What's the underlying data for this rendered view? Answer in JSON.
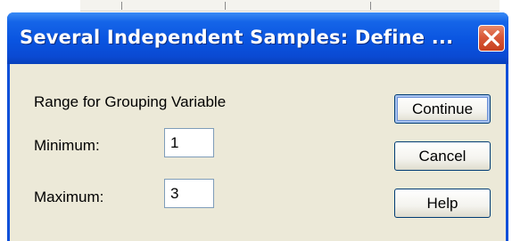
{
  "window": {
    "title": "Several Independent Samples: Define ..."
  },
  "group": {
    "heading": "Range for Grouping Variable"
  },
  "fields": {
    "minimum_label": "Minimum:",
    "minimum_value": "1",
    "maximum_label": "Maximum:",
    "maximum_value": "3"
  },
  "buttons": {
    "continue_label": "Continue",
    "cancel_label": "Cancel",
    "help_label": "Help"
  },
  "icons": {
    "close": "close-icon"
  },
  "colors": {
    "titlebar": "#0a54e0",
    "client_bg": "#ece9d8",
    "close_button": "#d9593a",
    "input_border": "#7f9db9",
    "button_border": "#003c74"
  }
}
